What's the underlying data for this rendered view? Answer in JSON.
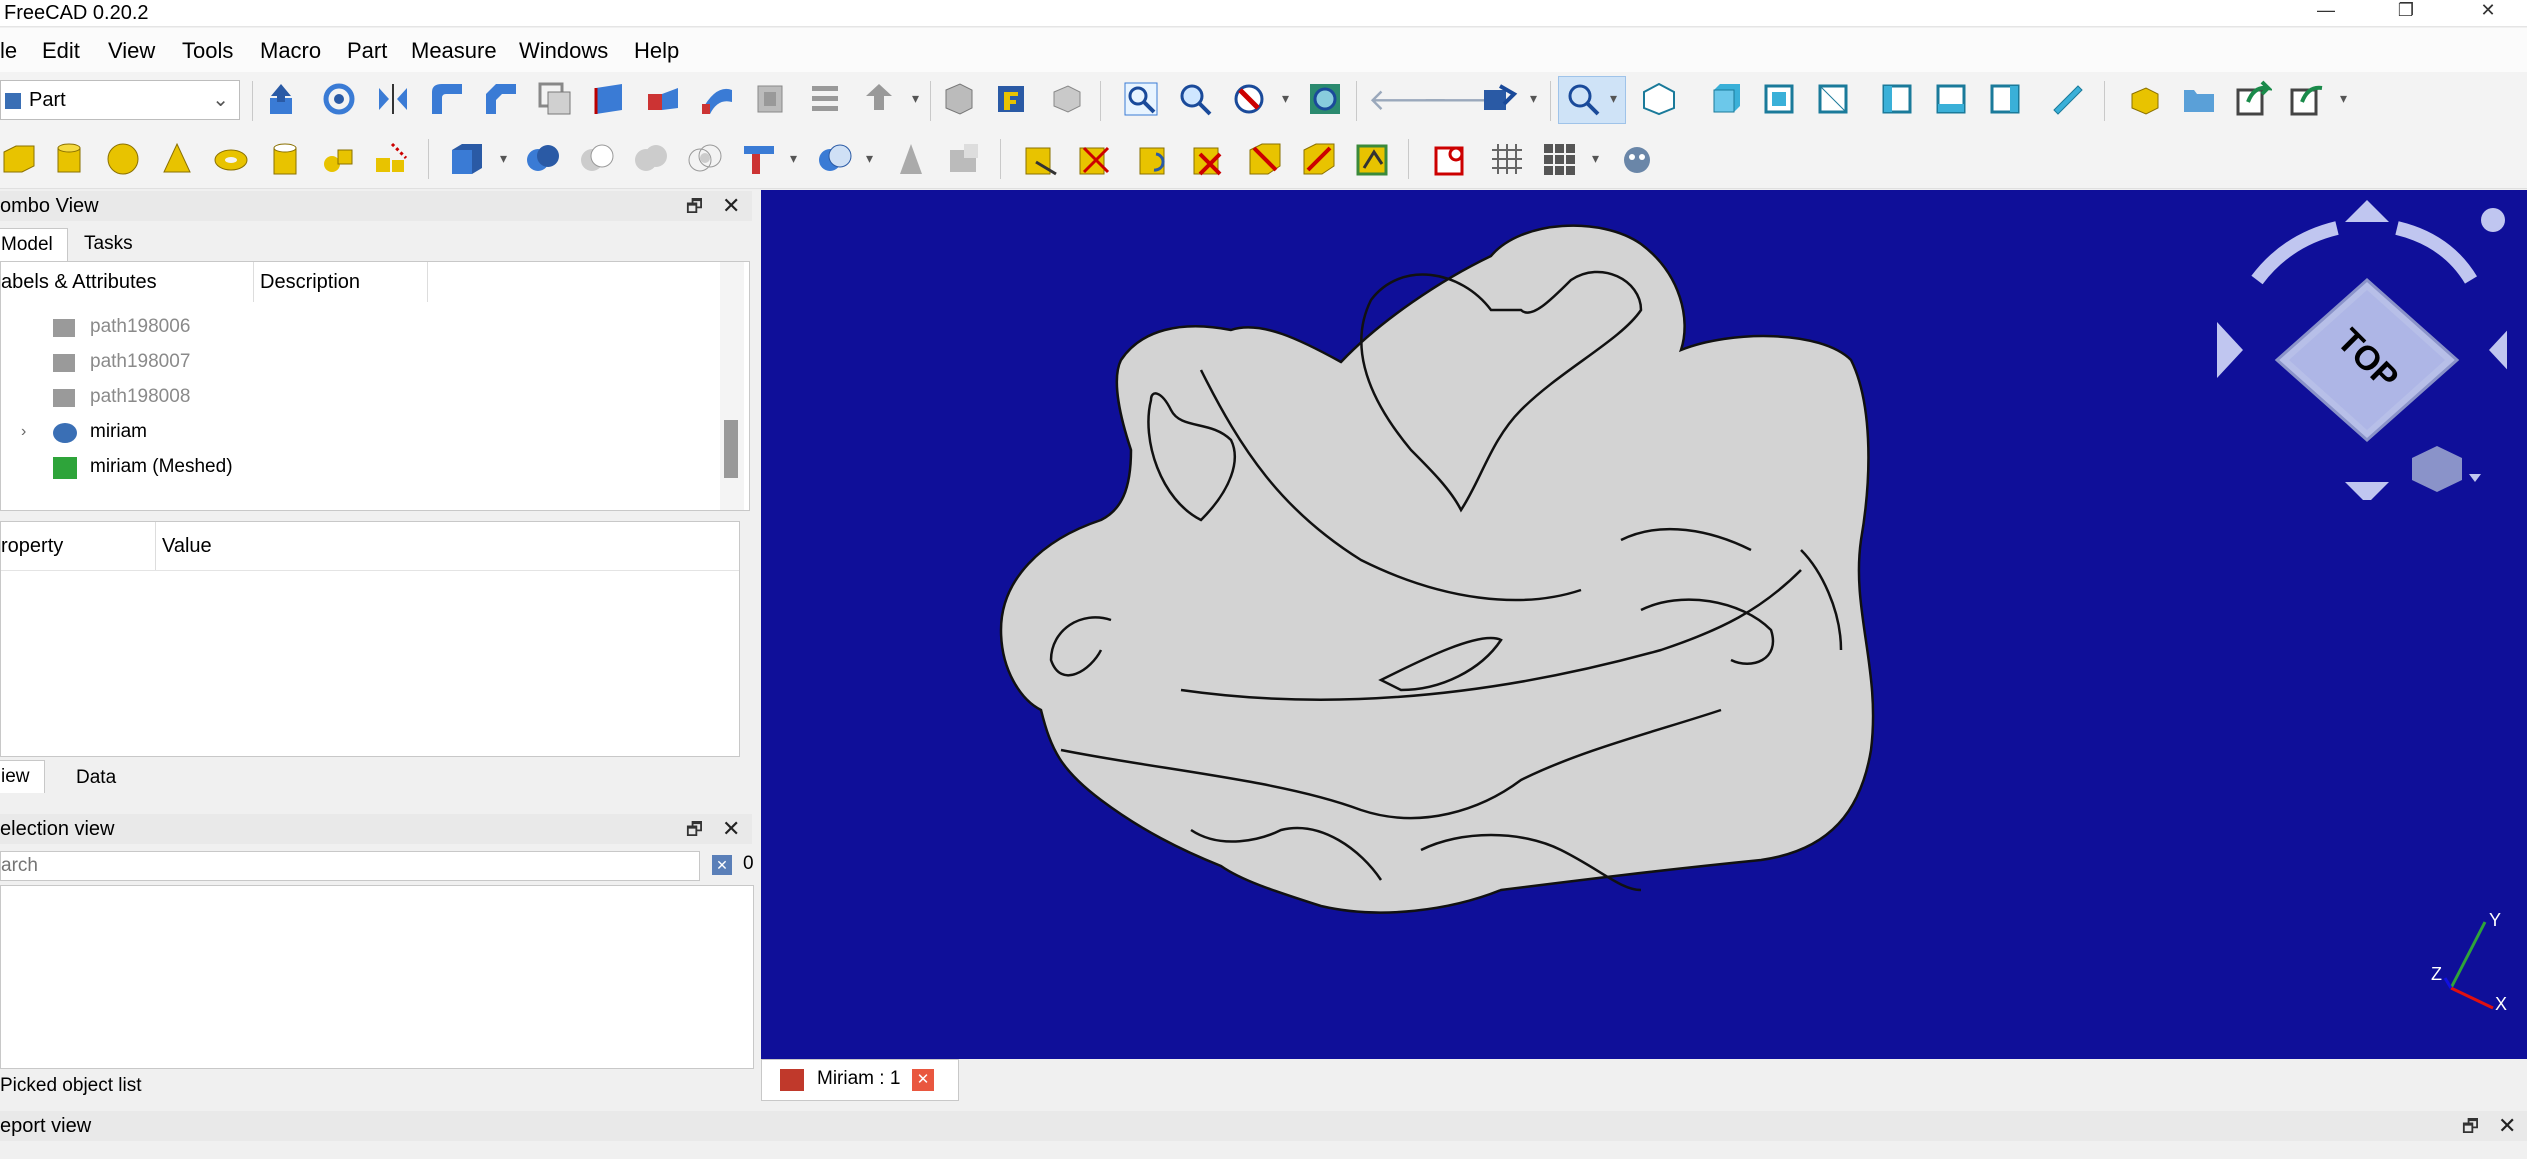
{
  "app": {
    "title": "FreeCAD 0.20.2"
  },
  "window_controls": {
    "minimize": "—",
    "maximize": "❐",
    "close": "✕"
  },
  "menu": [
    "le",
    "Edit",
    "View",
    "Tools",
    "Macro",
    "Part",
    "Measure",
    "Windows",
    "Help"
  ],
  "workbench": {
    "selected": "Part"
  },
  "combo_view": {
    "title": "ombo View",
    "tabs": [
      "Model",
      "Tasks"
    ],
    "tree_headers": [
      "abels & Attributes",
      "Description"
    ],
    "tree_items": [
      {
        "label": "path198006",
        "icon": "part-box-icon",
        "dim": true
      },
      {
        "label": "path198007",
        "icon": "part-box-icon",
        "dim": true
      },
      {
        "label": "path198008",
        "icon": "part-box-icon",
        "dim": true
      },
      {
        "label": "miriam",
        "icon": "part-body-icon",
        "dim": false
      },
      {
        "label": "miriam (Meshed)",
        "icon": "mesh-icon",
        "dim": false
      }
    ],
    "property_headers": [
      "roperty",
      "Value"
    ],
    "bottom_tabs": [
      "iew",
      "Data"
    ]
  },
  "selection_view": {
    "title": "election view",
    "search_placeholder": "arch",
    "count": "0",
    "footer": "Picked object list"
  },
  "document_tab": {
    "label": "Miriam : 1"
  },
  "report_view": {
    "title": "eport view"
  },
  "navcube": {
    "face": "TOP"
  },
  "axes": {
    "x": "X",
    "y": "Y",
    "z": "Z"
  },
  "colors": {
    "viewport_bg": "#0f0f99",
    "shape_fill": "#d3d3d3",
    "accent": "#3a7bd5"
  }
}
